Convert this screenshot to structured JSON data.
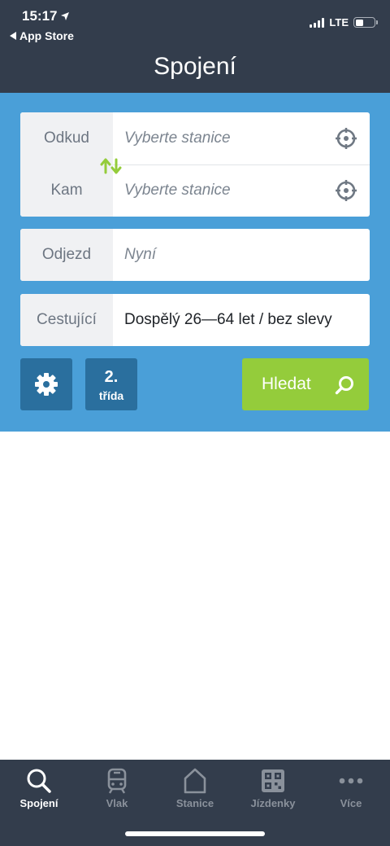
{
  "status": {
    "time": "15:17",
    "back_app": "App Store",
    "network": "LTE",
    "battery_level": 0.45
  },
  "header": {
    "title": "Spojení"
  },
  "route": {
    "from_label": "Odkud",
    "from_placeholder": "Vyberte stanice",
    "to_label": "Kam",
    "to_placeholder": "Vyberte stanice"
  },
  "departure": {
    "label": "Odjezd",
    "value": "Nyní"
  },
  "passengers": {
    "label": "Cestující",
    "value": "Dospělý 26—64 let / bez slevy"
  },
  "actions": {
    "class_number": "2.",
    "class_label": "třída",
    "search_label": "Hledat"
  },
  "tabs": [
    {
      "label": "Spojení",
      "icon": "search-icon",
      "active": true
    },
    {
      "label": "Vlak",
      "icon": "train-icon",
      "active": false
    },
    {
      "label": "Stanice",
      "icon": "home-icon",
      "active": false
    },
    {
      "label": "Jízdenky",
      "icon": "qr-code-icon",
      "active": false
    },
    {
      "label": "Více",
      "icon": "more-icon",
      "active": false
    }
  ],
  "colors": {
    "header_bg": "#333d4c",
    "panel_bg": "#4a9fd8",
    "search_button": "#94cc3b",
    "secondary_button": "#2a6f9e",
    "swap_icon": "#94cc3b"
  }
}
